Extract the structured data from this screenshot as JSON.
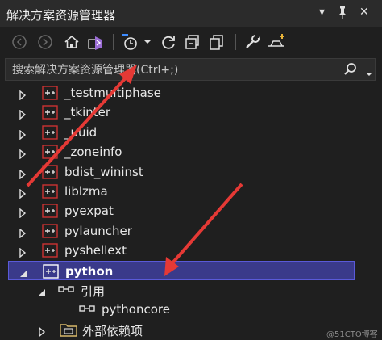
{
  "window": {
    "title": "解决方案资源管理器",
    "pin_glyph": "📌",
    "close_glyph": "✕",
    "menu_glyph": "▾"
  },
  "toolbar": {
    "icons": [
      "back-icon",
      "forward-icon",
      "home-icon",
      "vs-solution-icon",
      "pending-changes-filter-icon",
      "clock-icon",
      "refresh-icon",
      "collapse-all-icon",
      "show-all-files-icon",
      "properties-wrench-icon",
      "preview-icon"
    ]
  },
  "search": {
    "placeholder": "搜索解决方案资源管理器(Ctrl+;)"
  },
  "tree": {
    "items": [
      {
        "label": "_testmultiphase",
        "expanded": false,
        "selected": false,
        "level": 0
      },
      {
        "label": "_tkinter",
        "expanded": false,
        "selected": false,
        "level": 0
      },
      {
        "label": "_uuid",
        "expanded": false,
        "selected": false,
        "level": 0
      },
      {
        "label": "_zoneinfo",
        "expanded": false,
        "selected": false,
        "level": 0
      },
      {
        "label": "bdist_wininst",
        "expanded": false,
        "selected": false,
        "level": 0
      },
      {
        "label": "liblzma",
        "expanded": false,
        "selected": false,
        "level": 0
      },
      {
        "label": "pyexpat",
        "expanded": false,
        "selected": false,
        "level": 0
      },
      {
        "label": "pylauncher",
        "expanded": false,
        "selected": false,
        "level": 0
      },
      {
        "label": "pyshellext",
        "expanded": false,
        "selected": false,
        "level": 0
      },
      {
        "label": "python",
        "expanded": true,
        "selected": true,
        "level": 0
      },
      {
        "label": "引用",
        "expanded": true,
        "selected": false,
        "level": 1
      },
      {
        "label": "pythoncore",
        "expanded": false,
        "selected": false,
        "level": 2
      },
      {
        "label": "外部依赖项",
        "expanded": false,
        "selected": false,
        "level": 1
      }
    ]
  },
  "colors": {
    "background": "#1f1f1f",
    "selection": "#3a3a8a",
    "selection_border": "#5a5ad8",
    "annotation_arrow": "#e53935",
    "project_icon_border": "#cc3333"
  },
  "watermark": "@51CTO博客"
}
